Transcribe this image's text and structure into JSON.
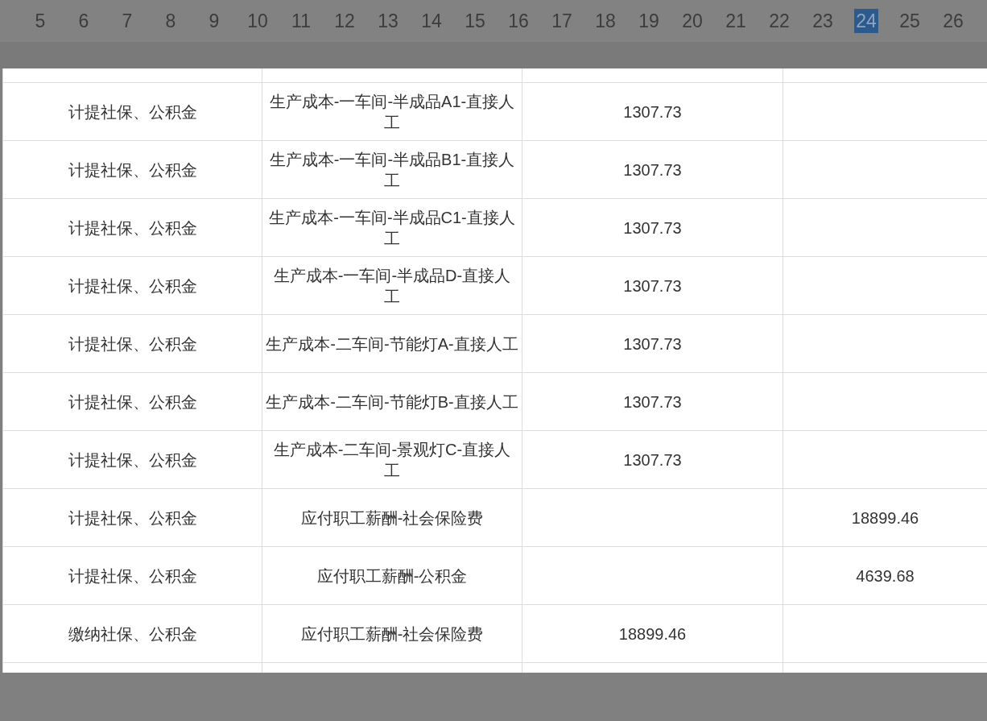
{
  "pager": {
    "pages": [
      {
        "label": "5",
        "selected": false
      },
      {
        "label": "6",
        "selected": false
      },
      {
        "label": "7",
        "selected": false
      },
      {
        "label": "8",
        "selected": false
      },
      {
        "label": "9",
        "selected": false
      },
      {
        "label": "10",
        "selected": false
      },
      {
        "label": "11",
        "selected": false
      },
      {
        "label": "12",
        "selected": false
      },
      {
        "label": "13",
        "selected": false
      },
      {
        "label": "14",
        "selected": false
      },
      {
        "label": "15",
        "selected": false
      },
      {
        "label": "16",
        "selected": false
      },
      {
        "label": "17",
        "selected": false
      },
      {
        "label": "18",
        "selected": false
      },
      {
        "label": "19",
        "selected": false
      },
      {
        "label": "20",
        "selected": false
      },
      {
        "label": "21",
        "selected": false
      },
      {
        "label": "22",
        "selected": false
      },
      {
        "label": "23",
        "selected": false
      },
      {
        "label": "24",
        "selected": true
      },
      {
        "label": "25",
        "selected": false
      },
      {
        "label": "26",
        "selected": false
      }
    ]
  },
  "table": {
    "rows": [
      {
        "summary": "计提社保、公积金",
        "account": "生产成本-一车间-半成品A1-直接人工",
        "debit": "1307.73",
        "credit": ""
      },
      {
        "summary": "计提社保、公积金",
        "account": "生产成本-一车间-半成品B1-直接人工",
        "debit": "1307.73",
        "credit": ""
      },
      {
        "summary": "计提社保、公积金",
        "account": "生产成本-一车间-半成品C1-直接人工",
        "debit": "1307.73",
        "credit": ""
      },
      {
        "summary": "计提社保、公积金",
        "account": "生产成本-一车间-半成品D-直接人工",
        "debit": "1307.73",
        "credit": ""
      },
      {
        "summary": "计提社保、公积金",
        "account": "生产成本-二车间-节能灯A-直接人工",
        "debit": "1307.73",
        "credit": ""
      },
      {
        "summary": "计提社保、公积金",
        "account": "生产成本-二车间-节能灯B-直接人工",
        "debit": "1307.73",
        "credit": ""
      },
      {
        "summary": "计提社保、公积金",
        "account": "生产成本-二车间-景观灯C-直接人工",
        "debit": "1307.73",
        "credit": ""
      },
      {
        "summary": "计提社保、公积金",
        "account": "应付职工薪酬-社会保险费",
        "debit": "",
        "credit": "18899.46"
      },
      {
        "summary": "计提社保、公积金",
        "account": "应付职工薪酬-公积金",
        "debit": "",
        "credit": "4639.68"
      },
      {
        "summary": "缴纳社保、公积金",
        "account": "应付职工薪酬-社会保险费",
        "debit": "18899.46",
        "credit": ""
      }
    ]
  }
}
